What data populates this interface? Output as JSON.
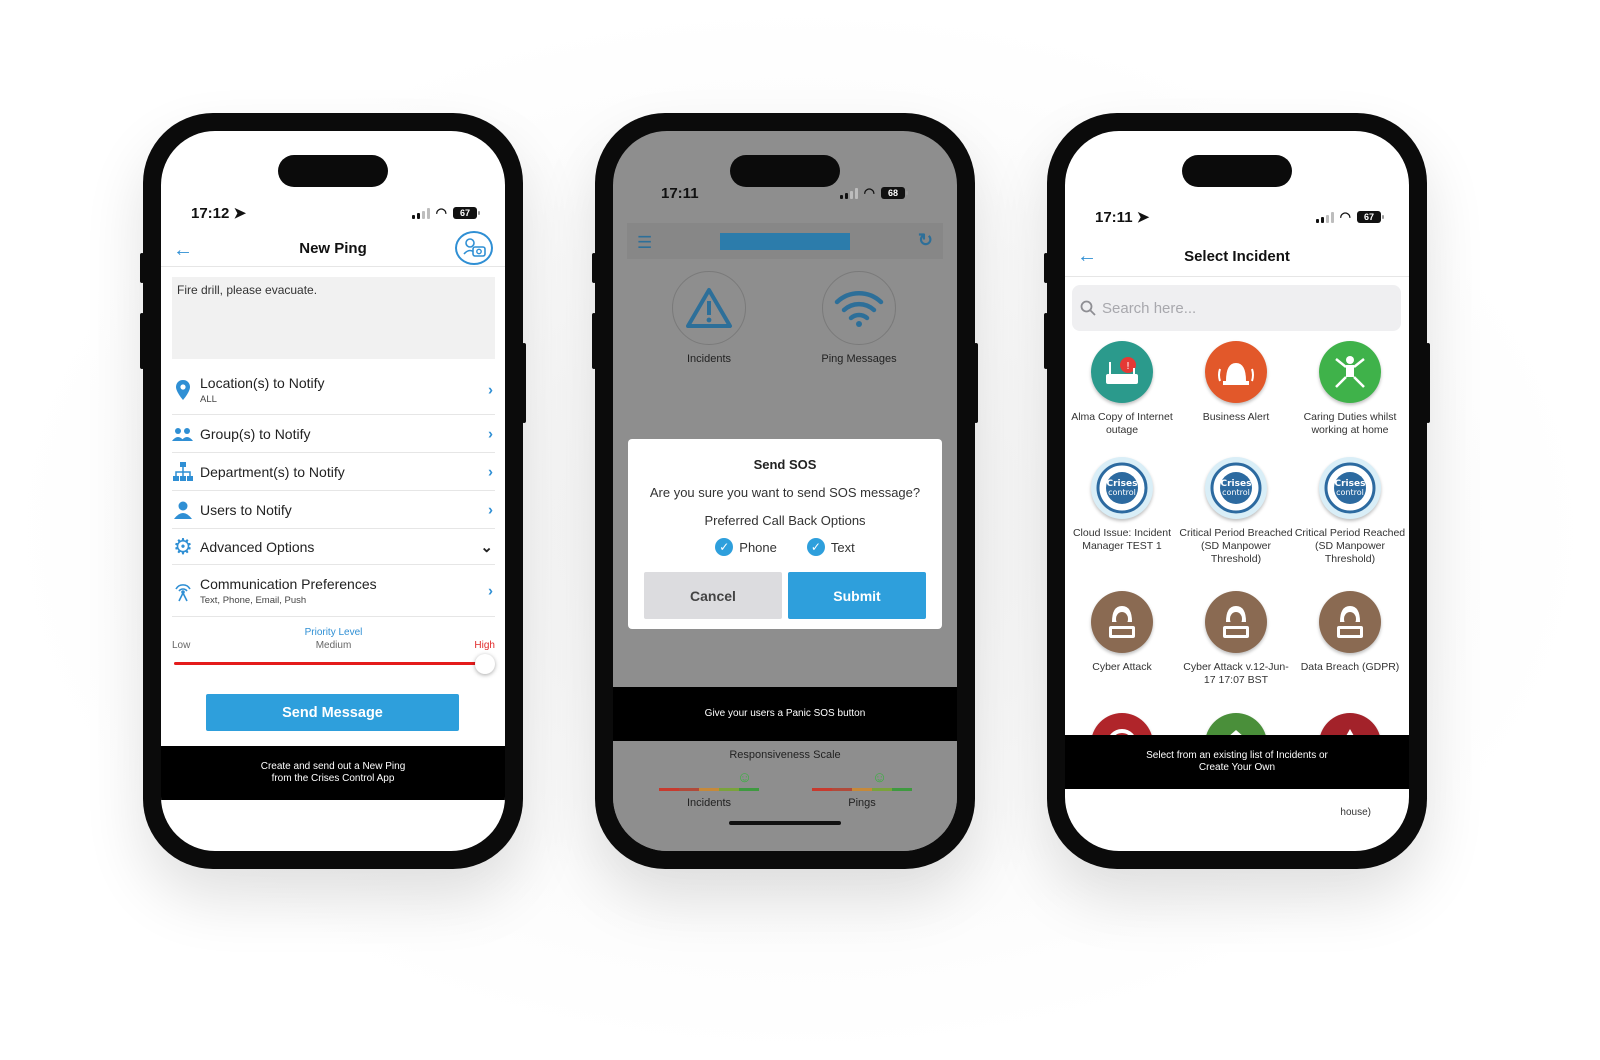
{
  "phone1": {
    "status_time": "17:12",
    "battery": "67",
    "nav_title": "New Ping",
    "message": "Fire drill, please evacuate.",
    "rows": [
      {
        "label": "Location(s) to Notify",
        "sub": "ALL"
      },
      {
        "label": "Group(s) to Notify",
        "sub": ""
      },
      {
        "label": "Department(s) to Notify",
        "sub": ""
      },
      {
        "label": "Users to Notify",
        "sub": ""
      },
      {
        "label": "Advanced Options",
        "sub": ""
      },
      {
        "label": "Communication Preferences",
        "sub": "Text, Phone, Email, Push"
      }
    ],
    "priority": {
      "title": "Priority Level",
      "current": "Medium",
      "low": "Low",
      "high": "High",
      "level_fraction": 1.0
    },
    "send_label": "Send Message",
    "caption_line1": "Create and send out a New Ping",
    "caption_line2": "from the Crises Control App"
  },
  "phone2": {
    "status_time": "17:11",
    "battery": "68",
    "tiles": [
      {
        "label": "Incidents"
      },
      {
        "label": "Ping Messages"
      }
    ],
    "dialog": {
      "title": "Send SOS",
      "question": "Are you sure you want to send SOS message?",
      "prompt": "Preferred Call Back Options",
      "options": [
        "Phone",
        "Text"
      ],
      "cancel": "Cancel",
      "submit": "Submit"
    },
    "caption": "Give your users a Panic SOS button",
    "responsiveness": {
      "title": "Responsiveness Scale",
      "left": "Incidents",
      "right": "Pings"
    }
  },
  "phone3": {
    "status_time": "17:11",
    "battery": "67",
    "nav_title": "Select Incident",
    "search_placeholder": "Search here...",
    "incidents": [
      {
        "label": "Alma Copy of Internet outage",
        "color": "#2b9a8c",
        "icon": "router-alert-icon"
      },
      {
        "label": "Business Alert",
        "color": "#e2582a",
        "icon": "alarm-bell-icon"
      },
      {
        "label": "Caring Duties whilst working at home",
        "color": "#3fb24a",
        "icon": "person-care-icon"
      },
      {
        "label": "Cloud Issue: Incident Manager TEST 1",
        "color": "#d9eef7",
        "icon": "crises-control-logo-icon"
      },
      {
        "label": "Critical Period Breached (SD Manpower Threshold)",
        "color": "#d9eef7",
        "icon": "crises-control-logo-icon"
      },
      {
        "label": "Critical Period Reached (SD Manpower Threshold)",
        "color": "#d9eef7",
        "icon": "crises-control-logo-icon"
      },
      {
        "label": "Cyber Attack",
        "color": "#8a6a52",
        "icon": "hacker-icon"
      },
      {
        "label": "Cyber Attack v.12-Jun-17 17:07 BST",
        "color": "#8a6a52",
        "icon": "hacker-icon"
      },
      {
        "label": "Data Breach (GDPR)",
        "color": "#8a6a52",
        "icon": "hacker-icon"
      }
    ],
    "partial_icons": [
      {
        "color": "#b0252a",
        "icon": "no-entry-icon"
      },
      {
        "color": "#4a8f3a",
        "icon": "house-alert-icon"
      },
      {
        "color": "#a3222a",
        "icon": "warning-icon"
      }
    ],
    "caption_line1": "Select from an existing list of Incidents or",
    "caption_line2": "Create Your Own",
    "tail_text": "house)"
  }
}
